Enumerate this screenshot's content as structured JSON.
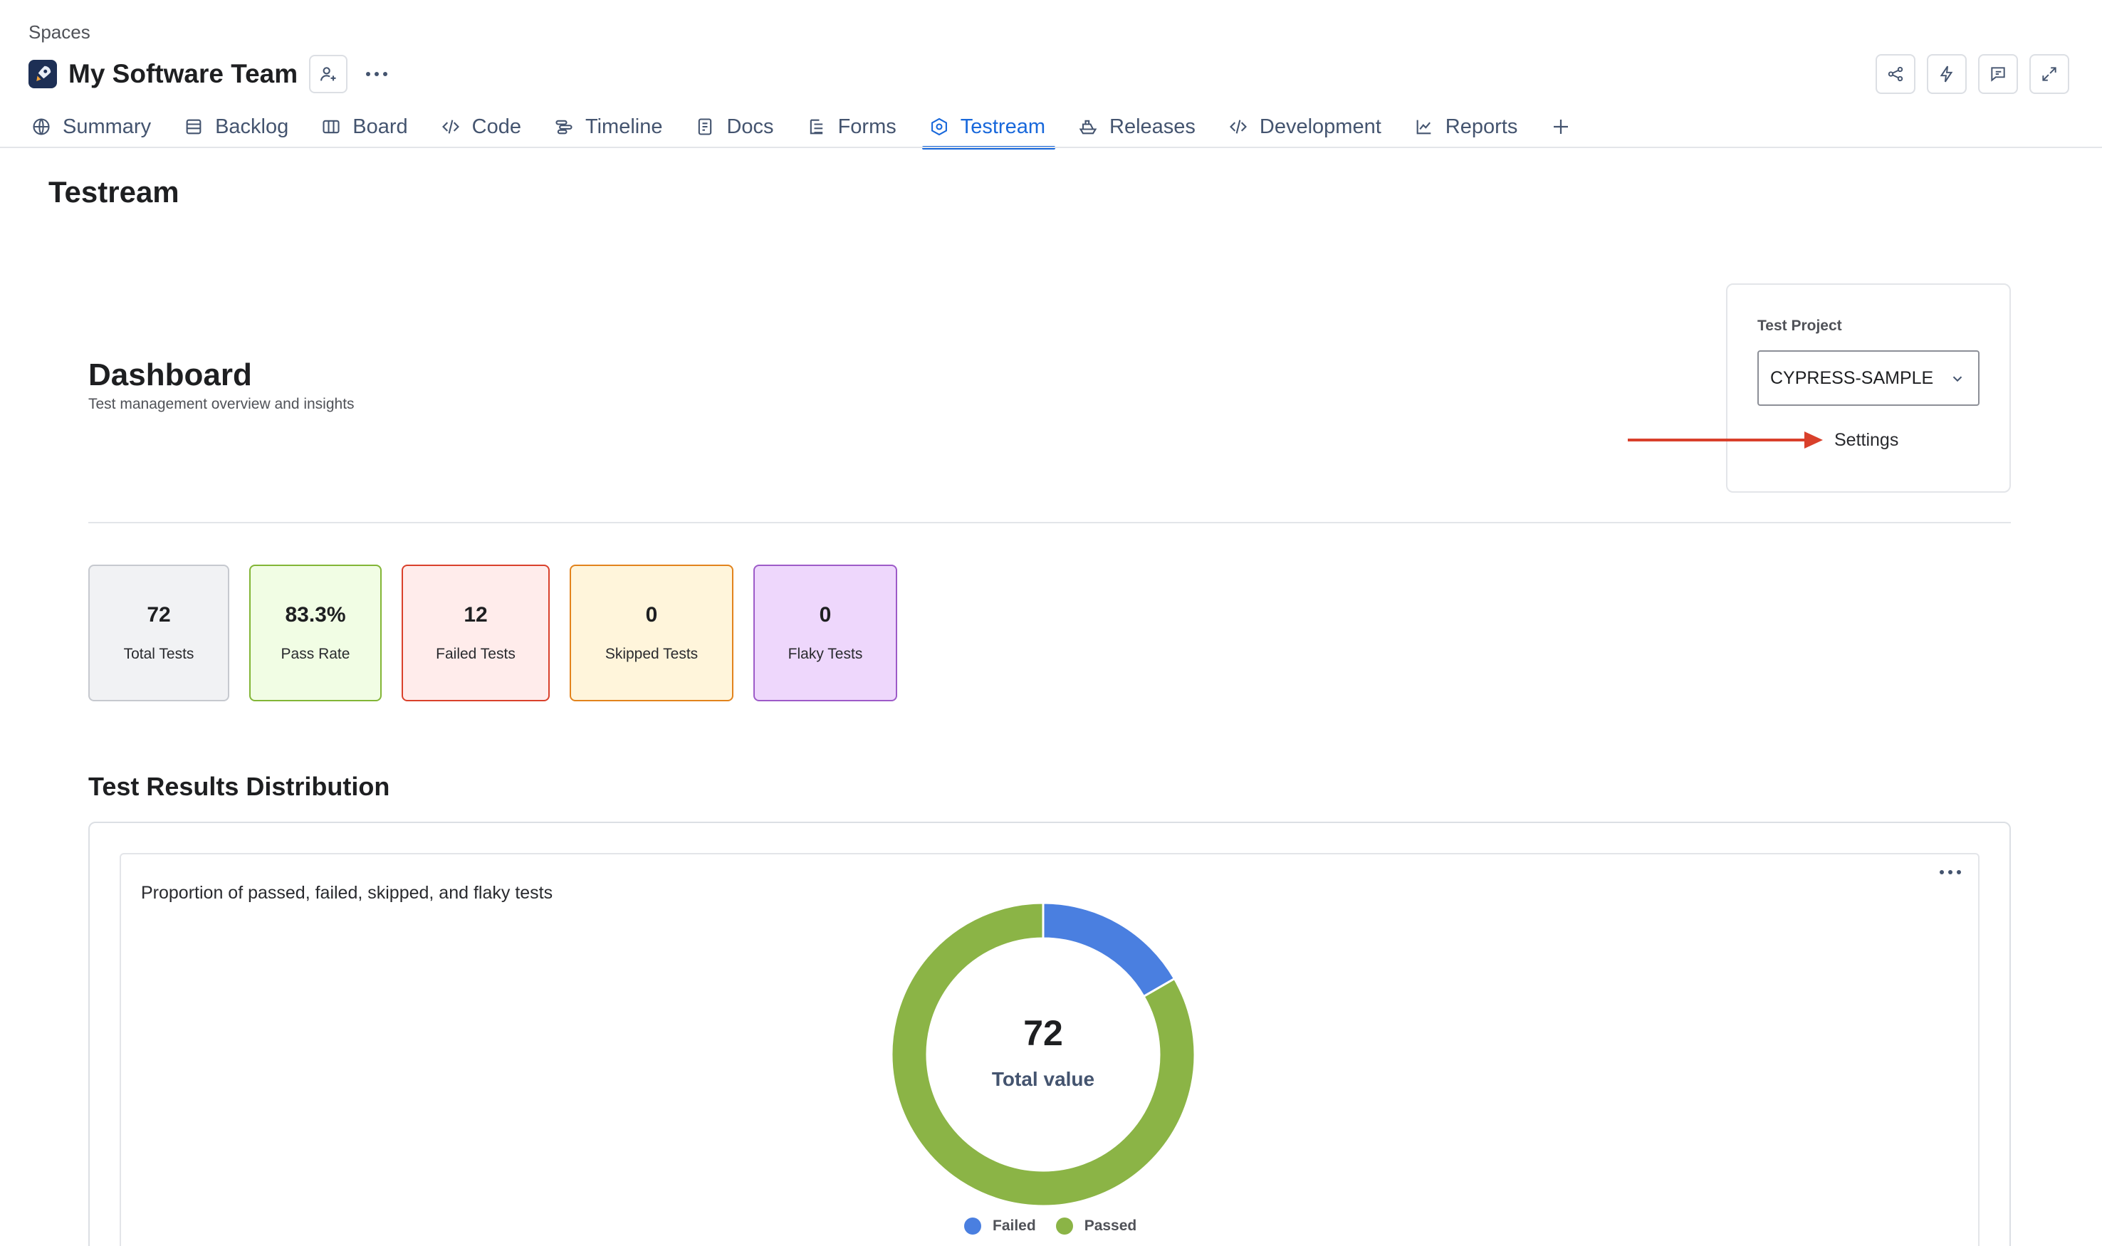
{
  "breadcrumb": "Spaces",
  "space": {
    "title": "My Software Team"
  },
  "tabs": [
    {
      "label": "Summary",
      "icon": "globe-icon"
    },
    {
      "label": "Backlog",
      "icon": "backlog-icon"
    },
    {
      "label": "Board",
      "icon": "board-icon"
    },
    {
      "label": "Code",
      "icon": "code-icon"
    },
    {
      "label": "Timeline",
      "icon": "timeline-icon"
    },
    {
      "label": "Docs",
      "icon": "docs-icon"
    },
    {
      "label": "Forms",
      "icon": "forms-icon"
    },
    {
      "label": "Testream",
      "icon": "testream-icon",
      "active": true
    },
    {
      "label": "Releases",
      "icon": "ship-icon"
    },
    {
      "label": "Development",
      "icon": "code-icon"
    },
    {
      "label": "Reports",
      "icon": "chart-line-icon"
    }
  ],
  "page": {
    "title": "Testream"
  },
  "dashboard": {
    "title": "Dashboard",
    "subtitle": "Test management overview and insights"
  },
  "project": {
    "label": "Test Project",
    "selected": "CYPRESS-SAMPLE",
    "settings_label": "Settings"
  },
  "stats": [
    {
      "value": "72",
      "label": "Total Tests"
    },
    {
      "value": "83.3%",
      "label": "Pass Rate"
    },
    {
      "value": "12",
      "label": "Failed Tests"
    },
    {
      "value": "0",
      "label": "Skipped Tests"
    },
    {
      "value": "0",
      "label": "Flaky Tests"
    }
  ],
  "distribution": {
    "title": "Test Results Distribution",
    "description": "Proportion of passed, failed, skipped, and flaky tests",
    "center_value": "72",
    "center_label": "Total value"
  },
  "chart_data": {
    "type": "pie",
    "categories": [
      "Failed",
      "Passed"
    ],
    "values": [
      12,
      60
    ],
    "colors": [
      "#4a7fe0",
      "#8bb446"
    ],
    "legend": "bottom"
  },
  "colors": {
    "accent": "#1868db",
    "annotation_arrow": "#d9402b"
  }
}
